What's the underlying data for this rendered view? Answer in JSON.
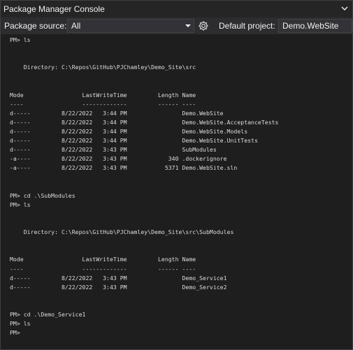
{
  "window": {
    "title": "Package Manager Console"
  },
  "toolbar": {
    "package_source_label": "Package source:",
    "package_source_value": "All",
    "default_project_label": "Default project:",
    "default_project_value": "Demo.WebSite"
  },
  "icons": {
    "settings": "gear-icon",
    "window_options": "chevron-down-icon",
    "dropdown_arrow": "chevron-down-icon"
  },
  "colors": {
    "background": "#1e1e1e",
    "text": "#dcdcdc",
    "toolbar": "#2d2d30",
    "title_bar": "#252526"
  },
  "console": {
    "lines": [
      "PM> ls",
      "",
      "",
      "    Directory: C:\\Repos\\GitHub\\PJChamley\\Demo_Site\\src",
      "",
      "",
      "Mode                 LastWriteTime         Length Name",
      "----                 -------------         ------ ----",
      "d-----         8/22/2022   3:44 PM                Demo.WebSite",
      "d-----         8/22/2022   3:44 PM                Demo.WebSite.AcceptanceTests",
      "d-----         8/22/2022   3:44 PM                Demo.WebSite.Models",
      "d-----         8/22/2022   3:44 PM                Demo.WebSite.UnitTests",
      "d-----         8/22/2022   3:43 PM                SubModules",
      "-a----         8/22/2022   3:43 PM            340 .dockerignore",
      "-a----         8/22/2022   3:43 PM           5371 Demo.WebSite.sln",
      "",
      "",
      "PM> cd .\\SubModules",
      "PM> ls",
      "",
      "",
      "    Directory: C:\\Repos\\GitHub\\PJChamley\\Demo_Site\\src\\SubModules",
      "",
      "",
      "Mode                 LastWriteTime         Length Name",
      "----                 -------------         ------ ----",
      "d-----         8/22/2022   3:43 PM                Demo_Service1",
      "d-----         8/22/2022   3:43 PM                Demo_Service2",
      "",
      "",
      "PM> cd .\\Demo_Service1",
      "PM> ls",
      "PM>"
    ]
  }
}
